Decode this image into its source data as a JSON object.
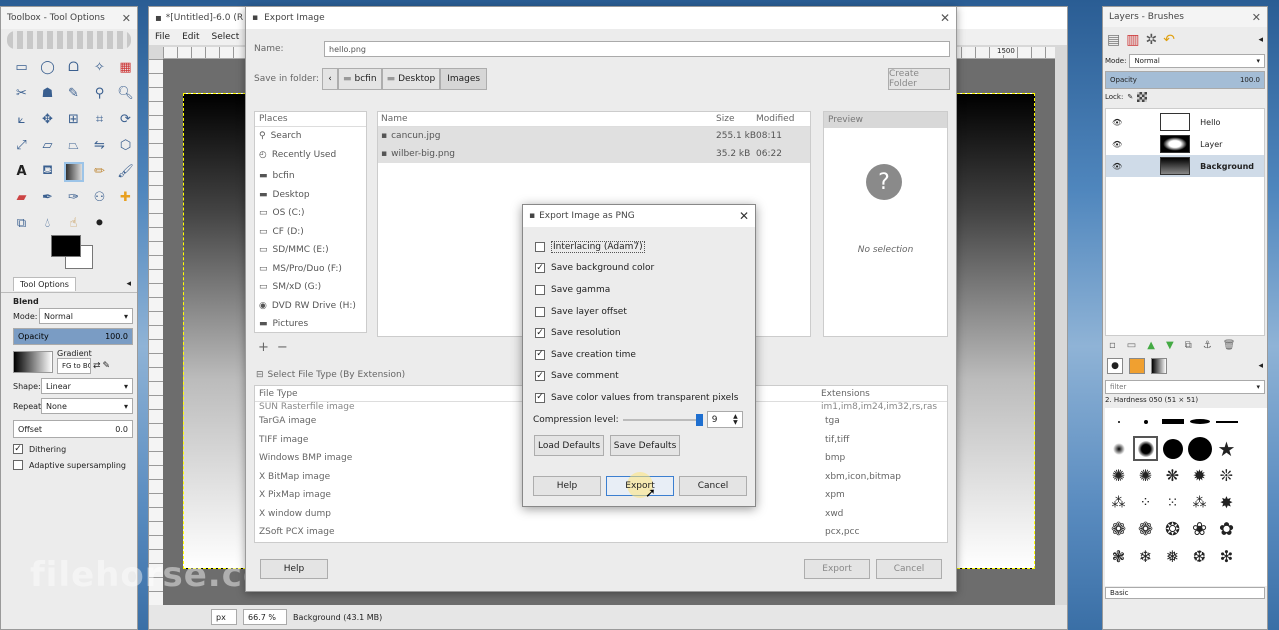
{
  "toolbox": {
    "title": "Toolbox - Tool Options",
    "tool_options_tab": "Tool Options",
    "tool_name": "Blend",
    "mode_label": "Mode:",
    "mode_value": "Normal",
    "opacity_label": "Opacity",
    "opacity_value": "100.0",
    "gradient_label": "Gradient",
    "gradient_value": "FG to BG",
    "shape_label": "Shape:",
    "shape_value": "Linear",
    "repeat_label": "Repeat:",
    "repeat_value": "None",
    "offset_label": "Offset",
    "offset_value": "0.0",
    "dithering_label": "Dithering",
    "adaptive_label": "Adaptive supersampling"
  },
  "image_window": {
    "title": "*[Untitled]-6.0 (R",
    "menu": [
      "File",
      "Edit",
      "Select"
    ],
    "ruler_mark": "1500",
    "status_unit": "px",
    "status_zoom": "66.7 %",
    "status_layer": "Background (43.1 MB)"
  },
  "export_dialog": {
    "title": "Export Image",
    "name_label": "Name:",
    "name_value": "hello.png",
    "save_in_label": "Save in folder:",
    "breadcrumb": [
      "bcfin",
      "Desktop",
      "Images"
    ],
    "create_folder": "Create Folder",
    "places_header": "Places",
    "places": [
      "Search",
      "Recently Used",
      "bcfin",
      "Desktop",
      "OS (C:)",
      "CF (D:)",
      "SD/MMC (E:)",
      "MS/Pro/Duo (F:)",
      "SM/xD (G:)",
      "DVD RW Drive (H:)",
      "Pictures"
    ],
    "col_name": "Name",
    "col_size": "Size",
    "col_modified": "Modified",
    "files": [
      {
        "name": "cancun.jpg",
        "size": "255.1 kB",
        "modified": "08:11"
      },
      {
        "name": "wilber-big.png",
        "size": "35.2 kB",
        "modified": "06:22"
      }
    ],
    "preview_header": "Preview",
    "preview_empty": "No selection",
    "filetype_toggle": "Select File Type (By Extension)",
    "col_filetype": "File Type",
    "col_extensions": "Extensions",
    "filetypes": [
      {
        "type": "SUN Rasterfile image",
        "ext": "im1,im8,im24,im32,rs,ras"
      },
      {
        "type": "TarGA image",
        "ext": "tga"
      },
      {
        "type": "TIFF image",
        "ext": "tif,tiff"
      },
      {
        "type": "Windows BMP image",
        "ext": "bmp"
      },
      {
        "type": "X BitMap image",
        "ext": "xbm,icon,bitmap"
      },
      {
        "type": "X PixMap image",
        "ext": "xpm"
      },
      {
        "type": "X window dump",
        "ext": "xwd"
      },
      {
        "type": "ZSoft PCX image",
        "ext": "pcx,pcc"
      }
    ],
    "help": "Help",
    "export": "Export",
    "cancel": "Cancel"
  },
  "png_dialog": {
    "title": "Export Image as PNG",
    "options": [
      {
        "label": "Interlacing (Adam7)",
        "checked": false
      },
      {
        "label": "Save background color",
        "checked": true
      },
      {
        "label": "Save gamma",
        "checked": false
      },
      {
        "label": "Save layer offset",
        "checked": false
      },
      {
        "label": "Save resolution",
        "checked": true
      },
      {
        "label": "Save creation time",
        "checked": true
      },
      {
        "label": "Save comment",
        "checked": true
      },
      {
        "label": "Save color values from transparent pixels",
        "checked": true
      }
    ],
    "compression_label": "Compression level:",
    "compression_value": "9",
    "compression_max": 9,
    "load_defaults": "Load Defaults",
    "save_defaults": "Save Defaults",
    "help": "Help",
    "export": "Export",
    "cancel": "Cancel"
  },
  "layers_panel": {
    "title": "Layers - Brushes",
    "mode_label": "Mode:",
    "mode_value": "Normal",
    "opacity_label": "Opacity",
    "opacity_value": "100.0",
    "lock_label": "Lock:",
    "layers": [
      "Hello",
      "Layer",
      "Background"
    ],
    "filter_placeholder": "filter",
    "brush_name": "2. Hardness 050 (51 × 51)",
    "preset": "Basic"
  },
  "watermark": "filehorse.com"
}
